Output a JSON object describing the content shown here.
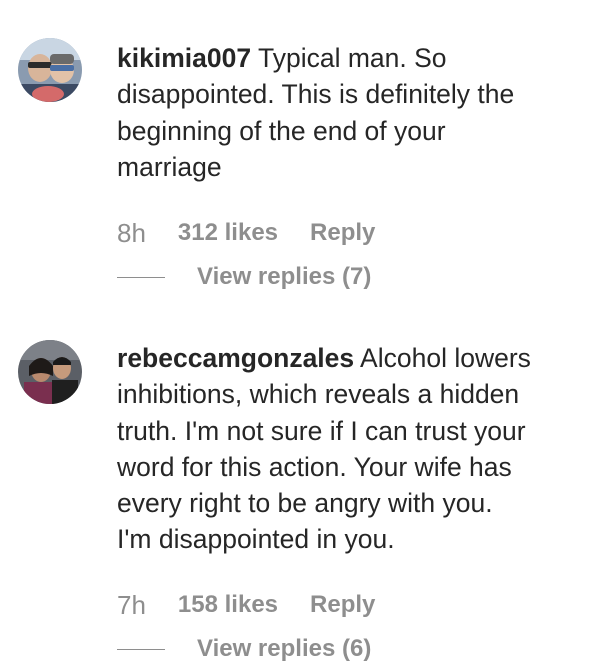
{
  "comments": [
    {
      "username": "kikimia007",
      "text": " Typical man. So\ndisappointed. This is definitely the\nbeginning of the end of your\nmarriage",
      "time": "8h",
      "likes": "312 likes",
      "reply": "Reply",
      "view_replies": "View replies (7)",
      "avatar_icon": "profile-photo-kikimia007"
    },
    {
      "username": "rebeccamgonzales",
      "text": " Alcohol lowers\ninhibitions, which reveals a hidden\ntruth. I'm not sure if I can trust your\nword for this action. Your wife has\nevery right to be angry with you.\nI'm disappointed in you.",
      "time": "7h",
      "likes": "158 likes",
      "reply": "Reply",
      "view_replies": "View replies (6)",
      "avatar_icon": "profile-photo-rebeccamgonzales"
    }
  ],
  "colors": {
    "text": "#262626",
    "meta": "#8e8e8e",
    "background": "#ffffff"
  }
}
